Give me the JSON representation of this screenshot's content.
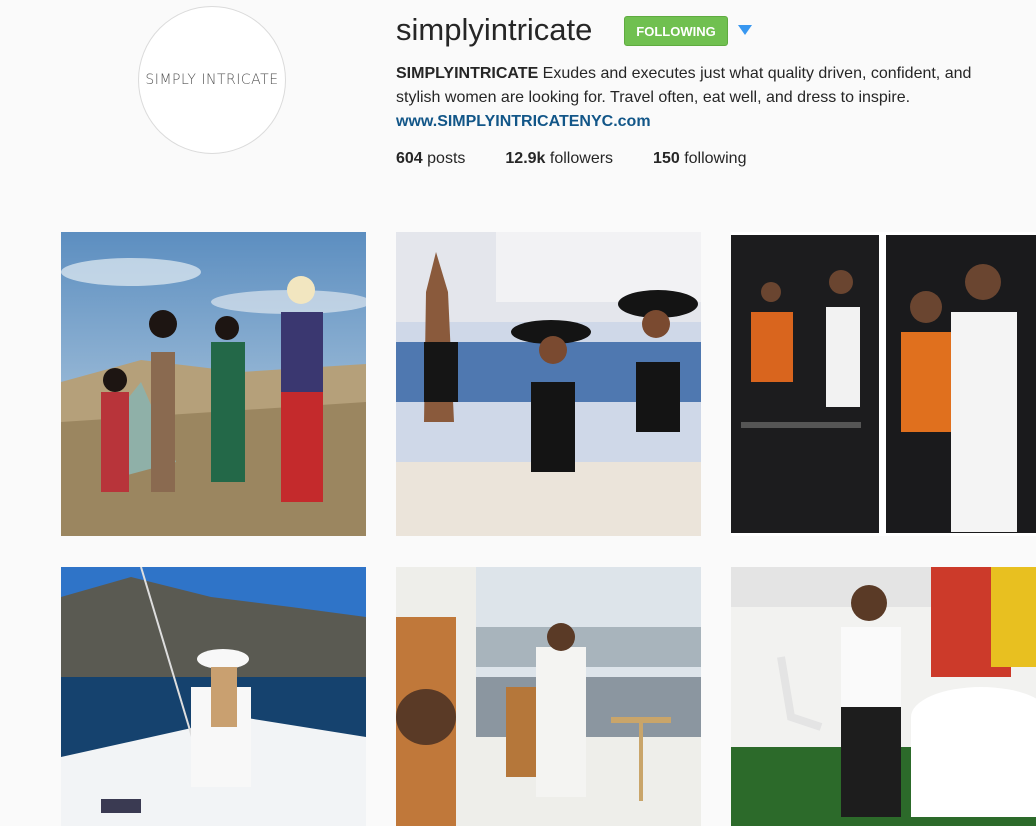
{
  "profile": {
    "avatar_text": "SIMPLY INTRICATE",
    "username": "simplyintricate",
    "follow_button": "FOLLOWING",
    "bio_name": "SIMPLYINTRICATE",
    "bio_text": " Exudes and executes just what quality driven, confident, and stylish women are looking for. Travel often, eat well, and dress to inspire.",
    "website": "www.SIMPLYINTRICATENYC.com",
    "stats": {
      "posts_count": "604",
      "posts_label": "posts",
      "followers_count": "12.9k",
      "followers_label": "followers",
      "following_count": "150",
      "following_label": "following"
    }
  },
  "colors": {
    "follow_green": "#70c050",
    "link_blue": "#125688",
    "dropdown_blue": "#3897f0"
  },
  "icons": {
    "dropdown": "triangle-down-icon"
  },
  "posts": [
    {
      "name": "post-models-in-dunes"
    },
    {
      "name": "post-women-on-yacht"
    },
    {
      "name": "post-event-red-carpet"
    },
    {
      "name": "post-woman-on-sailboat"
    },
    {
      "name": "post-woman-reading-by-window"
    },
    {
      "name": "post-woman-at-event-tent"
    }
  ]
}
